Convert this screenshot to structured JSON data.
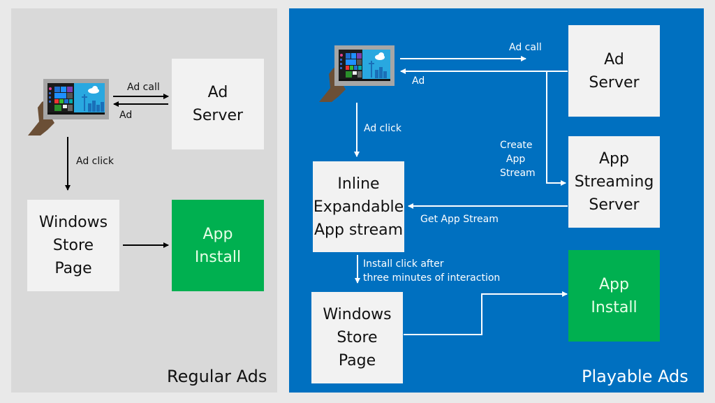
{
  "colors": {
    "page_bg": "#e9e9e9",
    "regular_panel_bg": "#d9d9d9",
    "playable_panel_bg": "#0070c0",
    "box_light": "#f2f2f2",
    "box_green": "#00b050",
    "arrow_dark": "#000000",
    "arrow_light": "#ffffff"
  },
  "regular_ads": {
    "title": "Regular Ads",
    "device_icon": "tablet-in-hand-icon",
    "boxes": {
      "ad_server": "Ad\nServer",
      "windows_store_page": "Windows\nStore\nPage",
      "app_install": "App\nInstall"
    },
    "labels": {
      "ad_call": "Ad call",
      "ad": "Ad",
      "ad_click": "Ad click"
    }
  },
  "playable_ads": {
    "title": "Playable Ads",
    "device_icon": "tablet-in-hand-icon",
    "boxes": {
      "ad_server": "Ad\nServer",
      "app_streaming_server": "App\nStreaming\nServer",
      "inline_expandable": "Inline\nExpandable\nApp stream",
      "windows_store_page": "Windows\nStore\nPage",
      "app_install": "App\nInstall"
    },
    "labels": {
      "ad_call": "Ad call",
      "ad": "Ad",
      "ad_click": "Ad click",
      "create_app_stream": "Create\n  App\nStream",
      "get_app_stream": "Get App Stream",
      "install_click": "Install click after\nthree minutes of interaction"
    }
  }
}
